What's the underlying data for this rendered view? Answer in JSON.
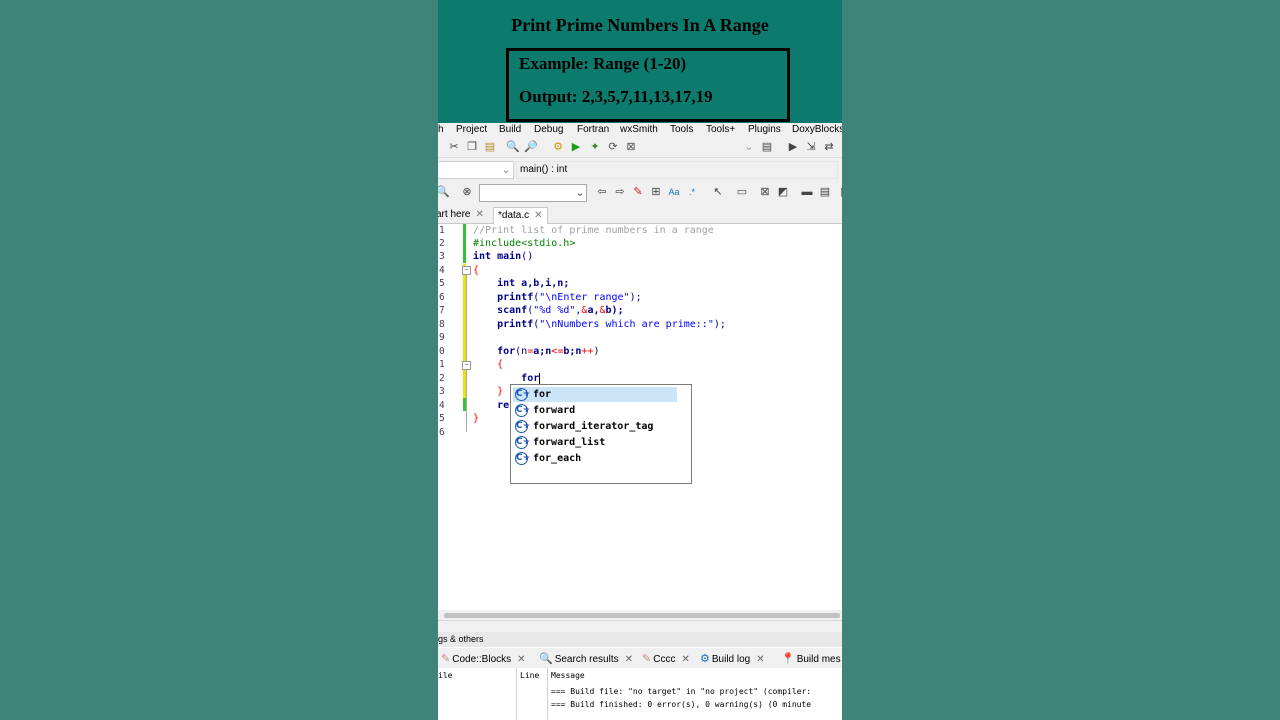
{
  "header": {
    "title": "Print Prime Numbers In A Range",
    "example": "Example: Range (1-20)",
    "output": "Output: 2,3,5,7,11,13,17,19"
  },
  "menubar": [
    "h",
    "Project",
    "Build",
    "Debug",
    "Fortran",
    "wxSmith",
    "Tools",
    "Tools+",
    "Plugins",
    "DoxyBlocks"
  ],
  "toolbar": {
    "scope_value": "main() : int",
    "search_value": ""
  },
  "tabs": {
    "start": "art here",
    "active": "*data.c"
  },
  "editor": {
    "line_numbers": [
      "1",
      "2",
      "3",
      "4",
      "5",
      "6",
      "7",
      "8",
      "9",
      "0",
      "1",
      "2",
      "3",
      "4",
      "5",
      "6"
    ],
    "lines": {
      "l1": "//Print list of prime numbers in a range",
      "l2": "#include<stdio.h>",
      "l3a": "int",
      "l3b": " main",
      "l3c": "()",
      "l4": "{",
      "l6a": "int",
      "l6b": " a,b,i,n;",
      "l7a": "printf",
      "l7b": "(",
      "l7c": "\"\\nEnter range\"",
      "l7d": ");",
      "l8a": "scanf",
      "l8b": "(",
      "l8c": "\"%d %d\"",
      "l8d": ",",
      "l8e": "&",
      "l8f": "a,",
      "l8g": "&",
      "l8h": "b);",
      "l9a": "printf",
      "l9b": "(",
      "l9c": "\"\\nNumbers which are prime::\"",
      "l9d": ");",
      "l11a": "for",
      "l11b": "(n",
      "l11c": "=",
      "l11d": "a;n",
      "l11e": "<=",
      "l11f": "b;n",
      "l11g": "++",
      "l11h": ")",
      "l12": "{",
      "l13": "for",
      "l14": "}",
      "l15": "re",
      "l16": "}"
    }
  },
  "autocomplete": {
    "items": [
      "for",
      "forward",
      "forward_iterator_tag",
      "forward_list",
      "for_each"
    ],
    "icon_glyph": "C+",
    "selected_index": 0
  },
  "logs": {
    "header": "gs & others",
    "tabs": [
      "Code::Blocks",
      "Search results",
      "Cccc",
      "Build log",
      "Build mes"
    ],
    "columns": [
      "ile",
      "Line",
      "Message"
    ],
    "rows": [
      "=== Build file: \"no target\" in \"no project\" (compiler:",
      "=== Build finished: 0 error(s), 0 warning(s) (0 minute"
    ]
  }
}
